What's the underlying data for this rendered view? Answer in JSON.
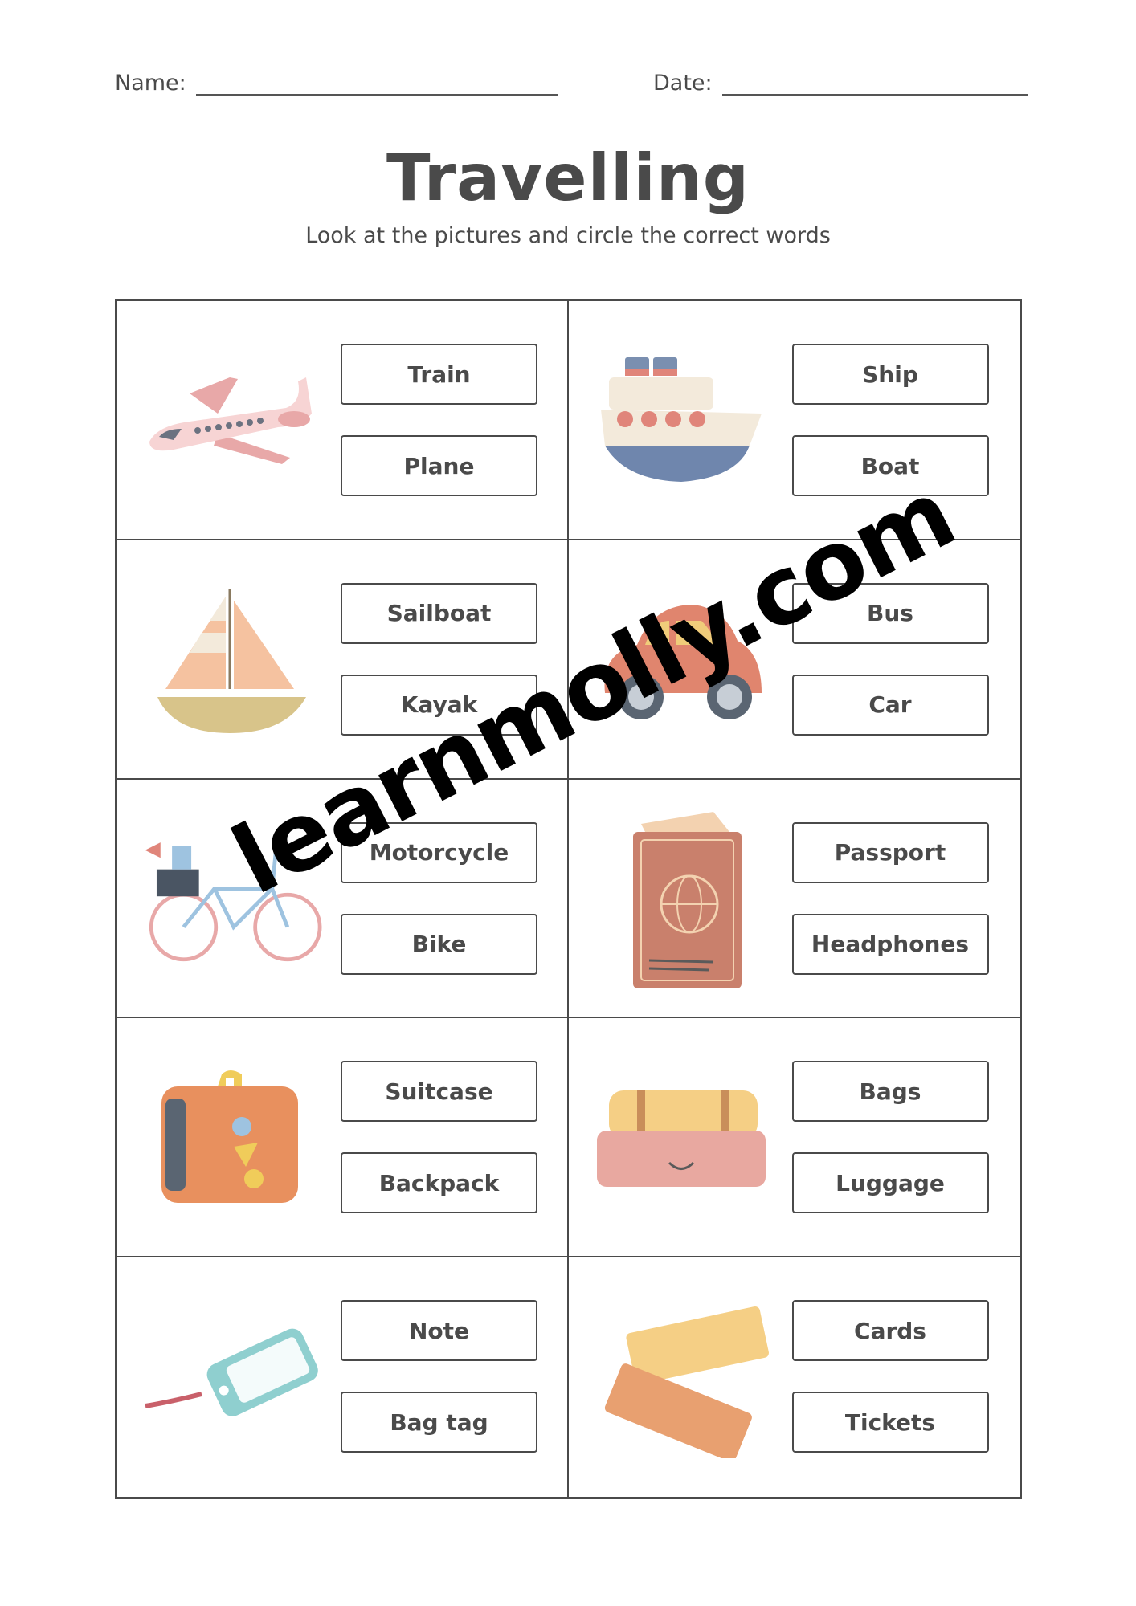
{
  "header": {
    "name_label": "Name:",
    "date_label": "Date:"
  },
  "title": "Travelling",
  "instructions": "Look at the pictures and circle the correct words",
  "items": [
    {
      "icon": "plane-icon",
      "options": [
        "Train",
        "Plane"
      ]
    },
    {
      "icon": "ship-icon",
      "options": [
        "Ship",
        "Boat"
      ]
    },
    {
      "icon": "sailboat-icon",
      "options": [
        "Sailboat",
        "Kayak"
      ]
    },
    {
      "icon": "car-icon",
      "options": [
        "Bus",
        "Car"
      ]
    },
    {
      "icon": "bicycle-icon",
      "options": [
        "Motorcycle",
        "Bike"
      ]
    },
    {
      "icon": "passport-icon",
      "options": [
        "Passport",
        "Headphones"
      ]
    },
    {
      "icon": "suitcase-icon",
      "options": [
        "Suitcase",
        "Backpack"
      ]
    },
    {
      "icon": "luggage-icon",
      "options": [
        "Bags",
        "Luggage"
      ]
    },
    {
      "icon": "bag-tag-icon",
      "options": [
        "Note",
        "Bag tag"
      ]
    },
    {
      "icon": "tickets-icon",
      "options": [
        "Cards",
        "Tickets"
      ]
    }
  ],
  "watermark": "learnmolly.com"
}
